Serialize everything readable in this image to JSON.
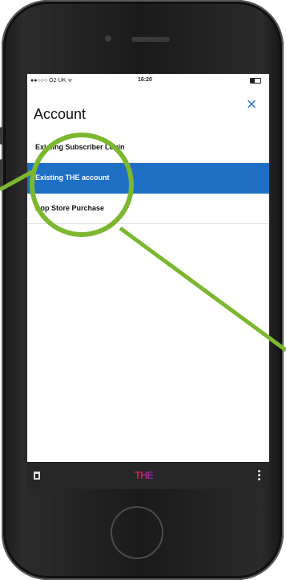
{
  "status_bar": {
    "carrier": "●●○○○ O2-UK ᯤ",
    "time": "16:20"
  },
  "account_panel": {
    "title": "Account",
    "close_icon": "×",
    "items": [
      {
        "label": "Existing Subscriber Login",
        "active": false
      },
      {
        "label": "Existing THE account",
        "active": true
      },
      {
        "label": "App Store Purchase",
        "active": false
      }
    ]
  },
  "toolbar": {
    "logo": "THE"
  },
  "colors": {
    "accent_blue": "#1f6fc5",
    "highlight_green": "#7cb82f",
    "toolbar_bg": "#262626"
  }
}
